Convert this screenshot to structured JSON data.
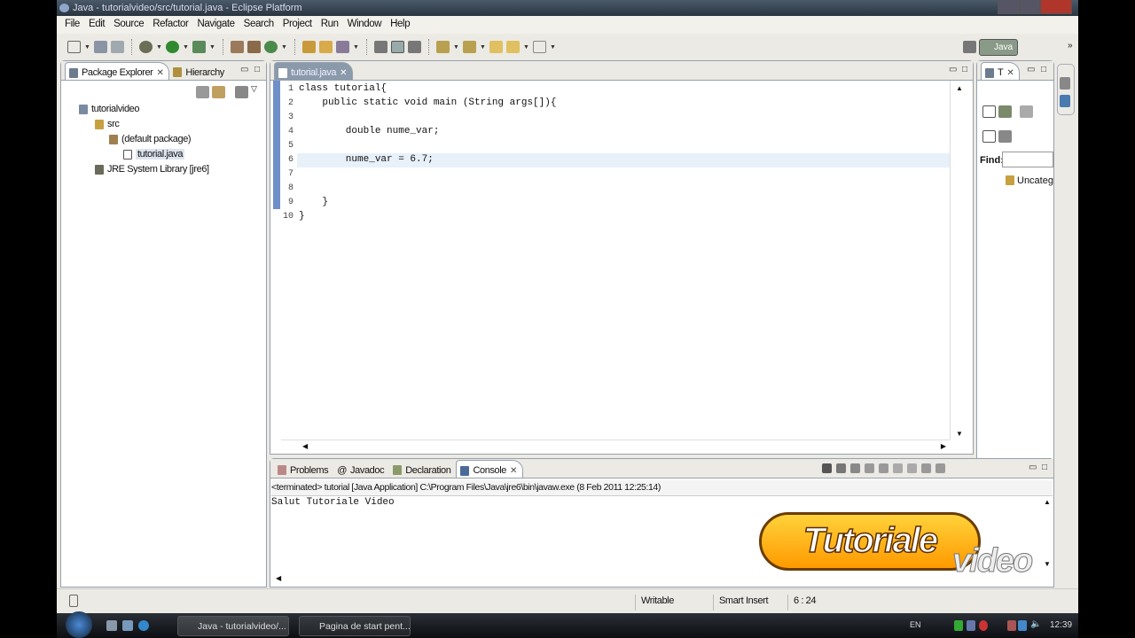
{
  "window": {
    "title": "Java - tutorialvideo/src/tutorial.java - Eclipse Platform"
  },
  "menu": [
    "File",
    "Edit",
    "Source",
    "Refactor",
    "Navigate",
    "Search",
    "Project",
    "Run",
    "Window",
    "Help"
  ],
  "perspective": {
    "label": "Java"
  },
  "package_explorer": {
    "tabs": [
      "Package Explorer",
      "Hierarchy"
    ],
    "tree": [
      {
        "label": "tutorialvideo"
      },
      {
        "label": "src"
      },
      {
        "label": "(default package)"
      },
      {
        "label": "tutorial.java"
      },
      {
        "label": "JRE System Library [jre6]"
      }
    ]
  },
  "editor": {
    "tab": "tutorial.java",
    "line_numbers": [
      "1",
      "2",
      "3",
      "4",
      "5",
      "6",
      "7",
      "8",
      "9",
      "10"
    ],
    "lines": [
      "class tutorial{",
      "    public static void main (String args[]){",
      "",
      "        double nume_var;",
      "",
      "        nume_var = 6.7;",
      "",
      "",
      "    }",
      "}"
    ]
  },
  "outline": {
    "tab": "T",
    "find_label": "Find:",
    "find_value": "",
    "item": "Uncateg"
  },
  "bottom": {
    "tabs": [
      "Problems",
      "Javadoc",
      "Declaration",
      "Console"
    ],
    "console_header": "<terminated> tutorial [Java Application] C:\\Program Files\\Java\\jre6\\bin\\javaw.exe (8 Feb 2011 12:25:14)",
    "console_output": "Salut Tutoriale Video"
  },
  "status": {
    "writable": "Writable",
    "insert_mode": "Smart Insert",
    "position": "6 : 24"
  },
  "taskbar": {
    "tasks": [
      "Java - tutorialvideo/...",
      "Pagina de start pent..."
    ],
    "lang": "EN",
    "clock": "12:39"
  },
  "watermark": {
    "text1": "Tutoriale",
    "text2": "video"
  }
}
